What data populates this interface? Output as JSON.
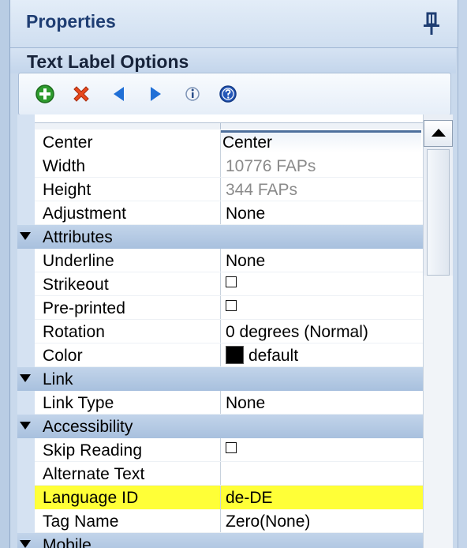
{
  "panel": {
    "title": "Properties",
    "section": "Text Label Options"
  },
  "toolbar": {
    "buttons": [
      "add-icon",
      "delete-icon",
      "previous-icon",
      "next-icon",
      "info-icon",
      "help-icon"
    ]
  },
  "grid": {
    "rows": [
      {
        "name": "Center",
        "value": "Center"
      },
      {
        "name": "Width",
        "value": "10776 FAPs"
      },
      {
        "name": "Height",
        "value": "344 FAPs"
      },
      {
        "name": "Adjustment",
        "value": "None"
      },
      {
        "category": "Attributes"
      },
      {
        "name": "Underline",
        "value": "None"
      },
      {
        "name": "Strikeout",
        "value": ""
      },
      {
        "name": "Pre-printed",
        "value": ""
      },
      {
        "name": "Rotation",
        "value": "0 degrees (Normal)"
      },
      {
        "name": "Color",
        "value": "default"
      },
      {
        "category": "Link"
      },
      {
        "name": "Link Type",
        "value": "None"
      },
      {
        "category": "Accessibility"
      },
      {
        "name": "Skip Reading",
        "value": ""
      },
      {
        "name": "Alternate Text",
        "value": ""
      },
      {
        "name": "Language ID",
        "value": "de-DE"
      },
      {
        "name": "Tag Name",
        "value": "Zero(None)"
      },
      {
        "category": "Mobile"
      }
    ]
  },
  "colors": {
    "highlight": "#ffff37",
    "category_band": "#b3c8e2",
    "title_text": "#1f3e73",
    "color_swatch": "#000000"
  }
}
